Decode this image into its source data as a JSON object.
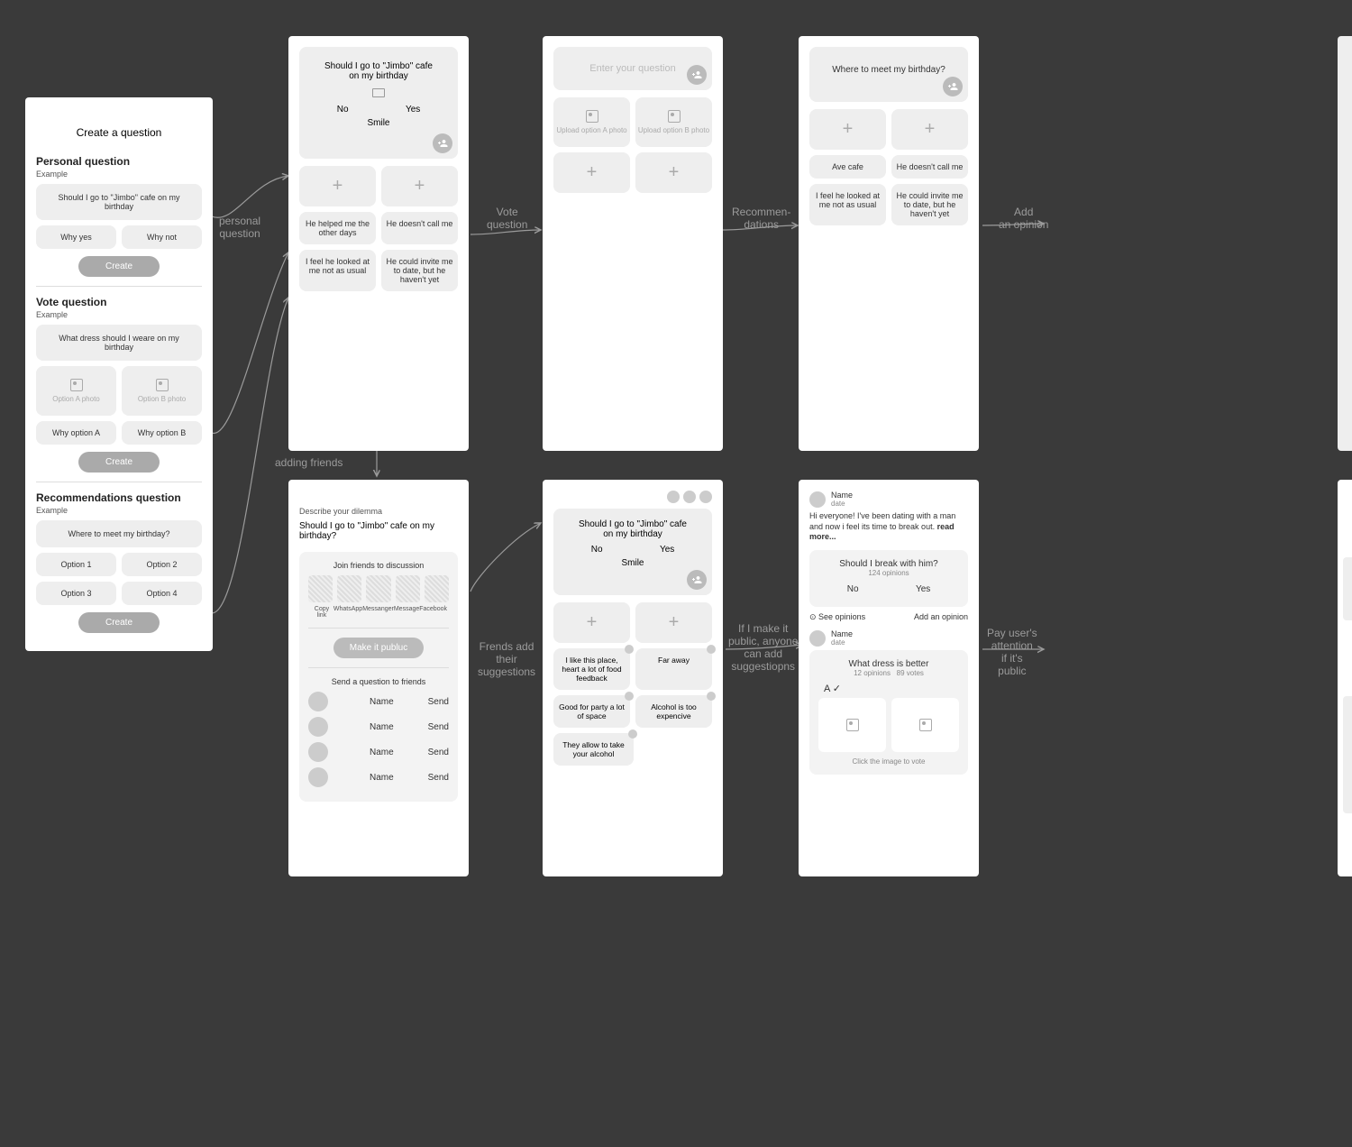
{
  "labels": {
    "personal": "personal\nquestion",
    "adding_friends": "adding friends",
    "vote": "Vote\nquestion",
    "recom": "Recommen-\ndations",
    "add_opinion": "Add\nan opinion",
    "friends_add": "Frends add\ntheir\nsuggestions",
    "public": "If I make it\npublic, anyone\ncan add\nsuggestiopns",
    "pay": "Pay user's\nattention\nif it's\npublic"
  },
  "s1": {
    "title": "Create a question",
    "p_title": "Personal question",
    "p_sub": "Example",
    "p_q": "Should I go to \"Jimbo\" cafe on my birthday",
    "p_yes": "Why yes",
    "p_no": "Why not",
    "v_title": "Vote question",
    "v_sub": "Example",
    "v_q": "What dress should I weare on my birthday",
    "v_optA": "Option A photo",
    "v_optB": "Option B photo",
    "v_whyA": "Why option A",
    "v_whyB": "Why option B",
    "r_title": "Recommendations question",
    "r_sub": "Example",
    "r_q": "Where to meet my birthday?",
    "r_o1": "Option 1",
    "r_o2": "Option 2",
    "r_o3": "Option 3",
    "r_o4": "Option 4",
    "create": "Create"
  },
  "s2": {
    "q": "Should I go to \"Jimbo\" cafe on my birthday",
    "no": "No",
    "yes": "Yes",
    "smile": "Smile",
    "c1": "He helped me the other days",
    "c2": "He doesn't call me",
    "c3": "I feel he looked at me not as usual",
    "c4": "He could invite me to date, but he haven't yet"
  },
  "s3": {
    "placeholder": "Enter your question",
    "uA": "Upload option A photo",
    "uB": "Upload option B photo"
  },
  "s4": {
    "q": "Where to meet my birthday?",
    "a": "Ave cafe",
    "b": "He doesn't call me",
    "c": "I feel he looked at me not as usual",
    "d": "He could invite me to date, but he haven't yet"
  },
  "s5": {
    "label": "Describe your dilemma",
    "text": "Should I go to \"Jimbo\" cafe on my birthday?",
    "join": "Join friends to discussion",
    "share": [
      "Copy link",
      "WhatsApp",
      "Messanger",
      "Message",
      "Facebook"
    ],
    "public_btn": "Make it publuc",
    "send_title": "Send a question to friends",
    "name": "Name",
    "send": "Send"
  },
  "s6": {
    "q": "Should I go to \"Jimbo\" cafe on my birthday",
    "no": "No",
    "yes": "Yes",
    "smile": "Smile",
    "sug1": "I like this place, heart a lot of food feedback",
    "sug2": "Far away",
    "sug3": "Good for party a lot of space",
    "sug4": "Alcohol is too expencive",
    "sug5": "They allow to take your alcohol"
  },
  "s7": {
    "name": "Name",
    "date": "date",
    "intro": "Hi everyone! I've been dating with a man and now i feel its time to break out. ",
    "read_more": "read more...",
    "q1": "Should I break with him?",
    "q1_meta": "124 opinions",
    "no": "No",
    "yes": "Yes",
    "see": "See opinions",
    "add": "Add an opinion",
    "q2": "What dress is better",
    "q2_meta_a": "12 opinions",
    "q2_meta_b": "89 votes",
    "choice": "A ✓",
    "click": "Click the image to vote"
  }
}
